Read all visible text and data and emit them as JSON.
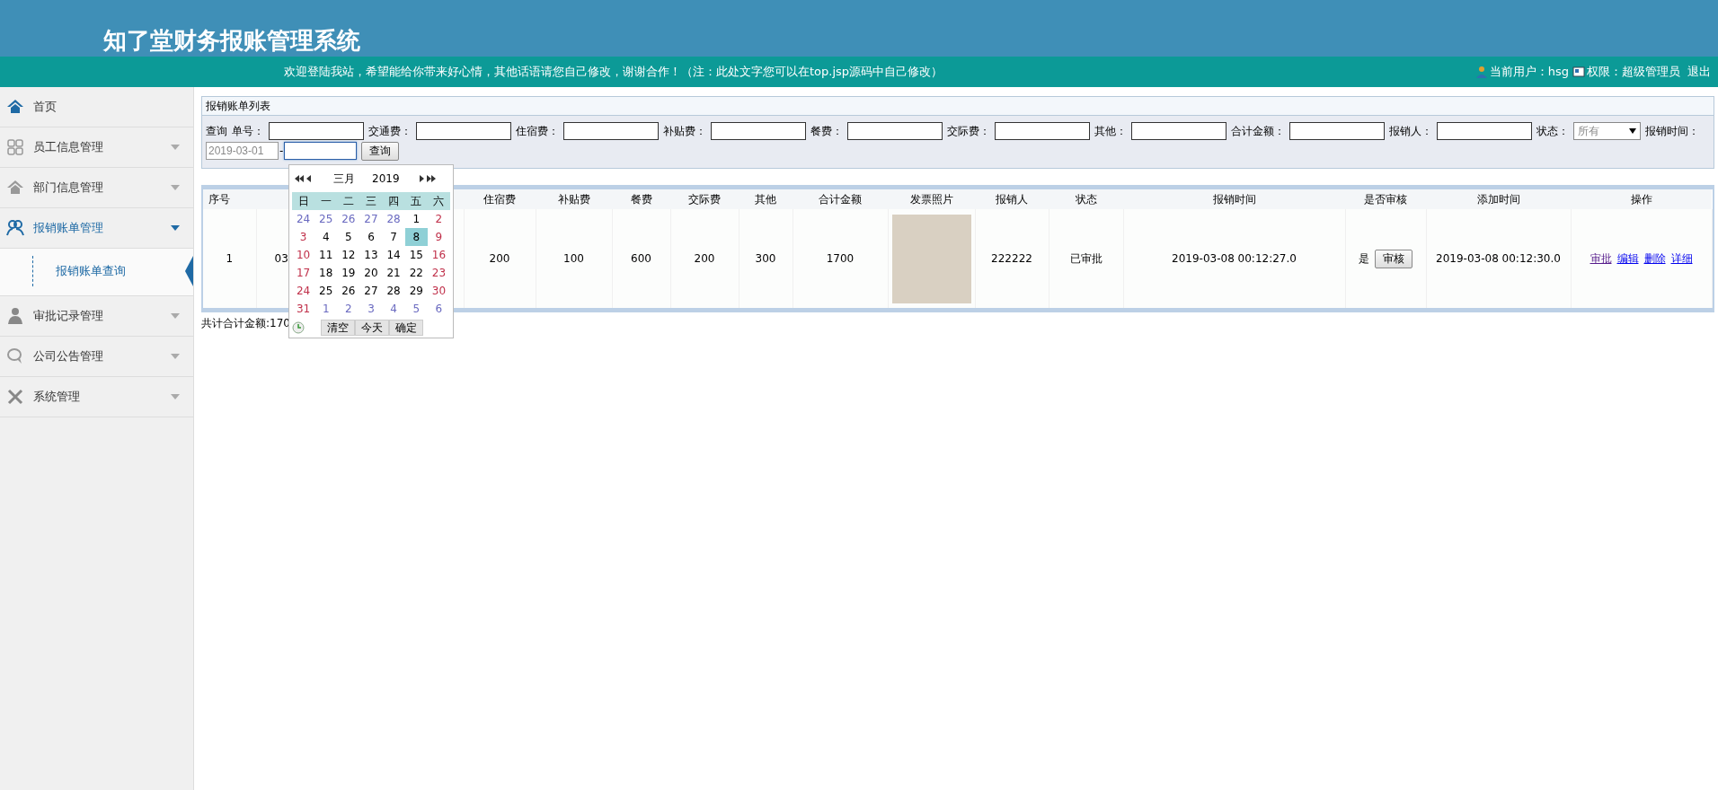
{
  "header": {
    "title": "知了堂财务报账管理系统",
    "welcome": "欢迎登陆我站，希望能给你带来好心情，其他话语请您自己修改，谢谢合作！（注：此处文字您可以在top.jsp源码中自己修改）",
    "user": "当前用户：hsg",
    "role": "权限：超级管理员",
    "logout": "退出"
  },
  "sidebar": {
    "items": [
      {
        "label": "首页",
        "expanded": false,
        "has_caret": false
      },
      {
        "label": "员工信息管理",
        "expanded": false,
        "has_caret": true
      },
      {
        "label": "部门信息管理",
        "expanded": false,
        "has_caret": true
      },
      {
        "label": "报销账单管理",
        "expanded": true,
        "has_caret": true,
        "children": [
          {
            "label": "报销账单查询",
            "selected": true
          }
        ]
      },
      {
        "label": "审批记录管理",
        "expanded": false,
        "has_caret": true
      },
      {
        "label": "公司公告管理",
        "expanded": false,
        "has_caret": true
      },
      {
        "label": "系统管理",
        "expanded": false,
        "has_caret": true
      }
    ]
  },
  "panel": {
    "title": "报销账单列表"
  },
  "search": {
    "prefix": "查询",
    "fields": [
      {
        "label": "单号：",
        "kind": "input"
      },
      {
        "label": "交通费：",
        "kind": "input"
      },
      {
        "label": "住宿费：",
        "kind": "input"
      },
      {
        "label": "补贴费：",
        "kind": "input"
      },
      {
        "label": "餐费：",
        "kind": "input"
      },
      {
        "label": "交际费：",
        "kind": "input"
      },
      {
        "label": "其他：",
        "kind": "input"
      },
      {
        "label": "合计金额：",
        "kind": "input"
      },
      {
        "label": "报销人：",
        "kind": "input"
      },
      {
        "label": "状态：",
        "kind": "select",
        "value": "所有"
      },
      {
        "label": "报销时间：",
        "kind": "label"
      }
    ],
    "date_from": "2019-03-01",
    "separator": "-",
    "button": "查询"
  },
  "calendar": {
    "month": "三月",
    "year": "2019",
    "weekdays": [
      "日",
      "一",
      "二",
      "三",
      "四",
      "五",
      "六"
    ],
    "weeks": [
      [
        {
          "day": "24",
          "in_month": false,
          "selected": false
        },
        {
          "day": "25",
          "in_month": false,
          "selected": false
        },
        {
          "day": "26",
          "in_month": false,
          "selected": false
        },
        {
          "day": "27",
          "in_month": false,
          "selected": false
        },
        {
          "day": "28",
          "in_month": false,
          "selected": false
        },
        {
          "day": "1",
          "in_month": true,
          "selected": false
        },
        {
          "day": "2",
          "in_month": true,
          "selected": false
        }
      ],
      [
        {
          "day": "3",
          "in_month": true,
          "selected": false
        },
        {
          "day": "4",
          "in_month": true,
          "selected": false
        },
        {
          "day": "5",
          "in_month": true,
          "selected": false
        },
        {
          "day": "6",
          "in_month": true,
          "selected": false
        },
        {
          "day": "7",
          "in_month": true,
          "selected": false
        },
        {
          "day": "8",
          "in_month": true,
          "selected": true
        },
        {
          "day": "9",
          "in_month": true,
          "selected": false
        }
      ],
      [
        {
          "day": "10",
          "in_month": true,
          "selected": false
        },
        {
          "day": "11",
          "in_month": true,
          "selected": false
        },
        {
          "day": "12",
          "in_month": true,
          "selected": false
        },
        {
          "day": "13",
          "in_month": true,
          "selected": false
        },
        {
          "day": "14",
          "in_month": true,
          "selected": false
        },
        {
          "day": "15",
          "in_month": true,
          "selected": false
        },
        {
          "day": "16",
          "in_month": true,
          "selected": false
        }
      ],
      [
        {
          "day": "17",
          "in_month": true,
          "selected": false
        },
        {
          "day": "18",
          "in_month": true,
          "selected": false
        },
        {
          "day": "19",
          "in_month": true,
          "selected": false
        },
        {
          "day": "20",
          "in_month": true,
          "selected": false
        },
        {
          "day": "21",
          "in_month": true,
          "selected": false
        },
        {
          "day": "22",
          "in_month": true,
          "selected": false
        },
        {
          "day": "23",
          "in_month": true,
          "selected": false
        }
      ],
      [
        {
          "day": "24",
          "in_month": true,
          "selected": false
        },
        {
          "day": "25",
          "in_month": true,
          "selected": false
        },
        {
          "day": "26",
          "in_month": true,
          "selected": false
        },
        {
          "day": "27",
          "in_month": true,
          "selected": false
        },
        {
          "day": "28",
          "in_month": true,
          "selected": false
        },
        {
          "day": "29",
          "in_month": true,
          "selected": false
        },
        {
          "day": "30",
          "in_month": true,
          "selected": false
        }
      ],
      [
        {
          "day": "31",
          "in_month": true,
          "selected": false
        },
        {
          "day": "1",
          "in_month": false,
          "selected": false
        },
        {
          "day": "2",
          "in_month": false,
          "selected": false
        },
        {
          "day": "3",
          "in_month": false,
          "selected": false
        },
        {
          "day": "4",
          "in_month": false,
          "selected": false
        },
        {
          "day": "5",
          "in_month": false,
          "selected": false
        },
        {
          "day": "6",
          "in_month": false,
          "selected": false
        }
      ]
    ],
    "buttons": [
      "清空",
      "今天",
      "确定"
    ]
  },
  "table": {
    "columns": [
      {
        "label": "序号"
      },
      {},
      {},
      {
        "label": "住宿费"
      },
      {
        "label": "补贴费"
      },
      {
        "label": "餐费"
      },
      {
        "label": "交际费"
      },
      {
        "label": "其他"
      },
      {
        "label": "合计金额"
      },
      {
        "label": "发票照片"
      },
      {
        "label": "报销人"
      },
      {
        "label": "状态"
      },
      {
        "label": "报销时间"
      },
      {
        "label": "是否审核"
      },
      {
        "label": "添加时间"
      },
      {
        "label": "操作"
      }
    ],
    "rows": [
      {
        "cells": [
          {
            "kind": "text",
            "text": "1"
          },
          {
            "kind": "text",
            "text": "03"
          },
          {
            "kind": "covered"
          },
          {
            "kind": "text",
            "text": "200"
          },
          {
            "kind": "text",
            "text": "100"
          },
          {
            "kind": "text",
            "text": "600"
          },
          {
            "kind": "text",
            "text": "200"
          },
          {
            "kind": "text",
            "text": "300"
          },
          {
            "kind": "text",
            "text": "1700"
          },
          {
            "kind": "photo"
          },
          {
            "kind": "text",
            "text": "222222"
          },
          {
            "kind": "text",
            "text": "已审批"
          },
          {
            "kind": "text",
            "text": "2019-03-08 00:12:27.0"
          },
          {
            "kind": "review",
            "text": "是",
            "button": "审核"
          },
          {
            "kind": "text",
            "text": "2019-03-08 00:12:30.0"
          },
          {
            "kind": "links",
            "links": [
              {
                "label": "审批",
                "visited": true
              },
              {
                "label": "编辑",
                "visited": false
              },
              {
                "label": "删除",
                "visited": false
              },
              {
                "label": "详细",
                "visited": false
              }
            ]
          }
        ]
      }
    ]
  },
  "total": "共计合计金额:170"
}
